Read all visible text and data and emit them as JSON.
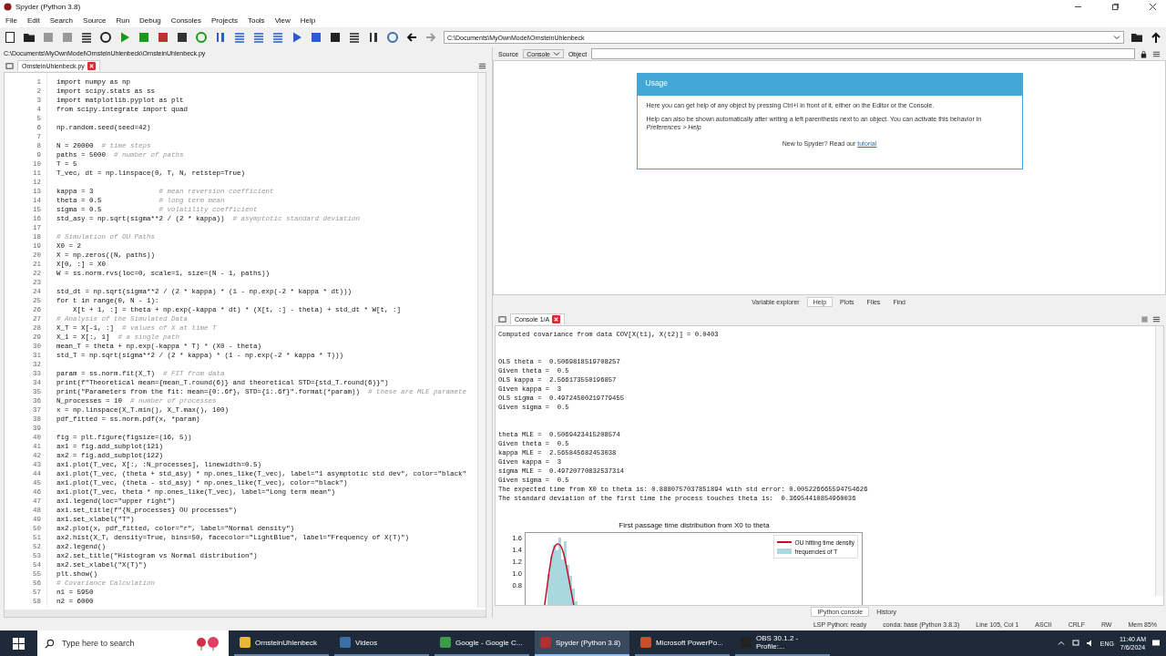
{
  "window": {
    "title": "Spyder (Python 3.8)"
  },
  "menu": [
    "File",
    "Edit",
    "Search",
    "Source",
    "Run",
    "Debug",
    "Consoles",
    "Projects",
    "Tools",
    "View",
    "Help"
  ],
  "toolbar": {
    "path": "C:\\Documents\\MyOwnModel\\OrnsteinUhlenbeck"
  },
  "editor": {
    "file_path": "C:\\Documents\\MyOwnModel\\OrnsteinUhlenbeck\\OrnsteinUhlenbeck.py",
    "tabs": [
      {
        "label": "OrnsteinUhlenbeck.py",
        "selected": true
      }
    ],
    "lines": [
      {
        "n": "1",
        "code": "import numpy as np"
      },
      {
        "n": "2",
        "code": "import scipy.stats as ss"
      },
      {
        "n": "3",
        "code": "import matplotlib.pyplot as plt"
      },
      {
        "n": "4",
        "code": "from scipy.integrate import quad"
      },
      {
        "n": "5"
      },
      {
        "n": "6",
        "code": "np.random.seed(seed=42)"
      },
      {
        "n": "7"
      },
      {
        "n": "8",
        "code": "N = 20000  ",
        "comment": "# time steps"
      },
      {
        "n": "9",
        "code": "paths = 5000  ",
        "comment": "# number of paths"
      },
      {
        "n": "10",
        "code": "T = 5"
      },
      {
        "n": "11",
        "code": "T_vec, dt = np.linspace(0, T, N, retstep=True)"
      },
      {
        "n": "12"
      },
      {
        "n": "13",
        "code": "kappa = 3                ",
        "comment": "# mean reversion coefficient"
      },
      {
        "n": "14",
        "code": "theta = 0.5              ",
        "comment": "# long term mean"
      },
      {
        "n": "15",
        "code": "sigma = 0.5              ",
        "comment": "# volatility coefficient"
      },
      {
        "n": "16",
        "code": "std_asy = np.sqrt(sigma**2 / (2 * kappa))  ",
        "comment": "# asymptotic standard deviation"
      },
      {
        "n": "17"
      },
      {
        "n": "18",
        "comment": "# Simulation of OU Paths"
      },
      {
        "n": "19",
        "code": "X0 = 2"
      },
      {
        "n": "20",
        "code": "X = np.zeros((N, paths))"
      },
      {
        "n": "21",
        "code": "X[0, :] = X0"
      },
      {
        "n": "22",
        "code": "W = ss.norm.rvs(loc=0, scale=1, size=(N - 1, paths))"
      },
      {
        "n": "23"
      },
      {
        "n": "24",
        "code": "std_dt = np.sqrt(sigma**2 / (2 * kappa) * (1 - np.exp(-2 * kappa * dt)))"
      },
      {
        "n": "25",
        "code": "for t in range(0, N - 1):"
      },
      {
        "n": "26",
        "code": "    X[t + 1, :] = theta + np.exp(-kappa * dt) * (X[t, :] - theta) + std_dt * W[t, :]"
      },
      {
        "n": "27",
        "comment": "# Analysis of the Simulated Data"
      },
      {
        "n": "28",
        "code": "X_T = X[-1, :]  ",
        "comment": "# values of X at time T"
      },
      {
        "n": "29",
        "code": "X_1 = X[:, 1]  ",
        "comment": "# a single path"
      },
      {
        "n": "30",
        "code": "mean_T = theta + np.exp(-kappa * T) * (X0 - theta)"
      },
      {
        "n": "31",
        "code": "std_T = np.sqrt(sigma**2 / (2 * kappa) * (1 - np.exp(-2 * kappa * T)))"
      },
      {
        "n": "32"
      },
      {
        "n": "33",
        "code": "param = ss.norm.fit(X_T)  ",
        "comment": "# FIT from data"
      },
      {
        "n": "34",
        "code": "print(f\"Theoretical mean={mean_T.round(6)} and theoretical STD={std_T.round(6)}\")"
      },
      {
        "n": "35",
        "code": "print(\"Parameters from the fit: mean={0:.6f}, STD={1:.6f}\".format(*param))  ",
        "comment": "# these are MLE paramete"
      },
      {
        "n": "36",
        "code": "N_processes = 10  ",
        "comment": "# number of processes"
      },
      {
        "n": "37",
        "code": "x = np.linspace(X_T.min(), X_T.max(), 100)"
      },
      {
        "n": "38",
        "code": "pdf_fitted = ss.norm.pdf(x, *param)"
      },
      {
        "n": "39"
      },
      {
        "n": "40",
        "code": "fig = plt.figure(figsize=(16, 5))"
      },
      {
        "n": "41",
        "code": "ax1 = fig.add_subplot(121)"
      },
      {
        "n": "42",
        "code": "ax2 = fig.add_subplot(122)"
      },
      {
        "n": "43",
        "code": "ax1.plot(T_vec, X[:, :N_processes], linewidth=0.5)"
      },
      {
        "n": "44",
        "code": "ax1.plot(T_vec, (theta + std_asy) * np.ones_like(T_vec), label=\"1 asymptotic std dev\", color=\"black\""
      },
      {
        "n": "45",
        "code": "ax1.plot(T_vec, (theta - std_asy) * np.ones_like(T_vec), color=\"black\")"
      },
      {
        "n": "46",
        "code": "ax1.plot(T_vec, theta * np.ones_like(T_vec), label=\"Long term mean\")"
      },
      {
        "n": "47",
        "code": "ax1.legend(loc=\"upper right\")"
      },
      {
        "n": "48",
        "code": "ax1.set_title(f\"{N_processes} OU processes\")"
      },
      {
        "n": "49",
        "code": "ax1.set_xlabel(\"T\")"
      },
      {
        "n": "50",
        "code": "ax2.plot(x, pdf_fitted, color=\"r\", label=\"Normal density\")"
      },
      {
        "n": "51",
        "code": "ax2.hist(X_T, density=True, bins=50, facecolor=\"LightBlue\", label=\"Frequency of X(T)\")"
      },
      {
        "n": "52",
        "code": "ax2.legend()"
      },
      {
        "n": "53",
        "code": "ax2.set_title(\"Histogram vs Normal distribution\")"
      },
      {
        "n": "54",
        "code": "ax2.set_xlabel(\"X(T)\")"
      },
      {
        "n": "55",
        "code": "plt.show()"
      },
      {
        "n": "56",
        "comment": "# Covariance Calculation"
      },
      {
        "n": "57",
        "code": "n1 = 5950"
      },
      {
        "n": "58",
        "code": "n2 = 6000"
      }
    ]
  },
  "help": {
    "source_label": "Source",
    "source_value": "Console",
    "object_label": "Object",
    "usage_title": "Usage",
    "paragraphs": [
      "Here you can get help of any object by pressing Ctrl+I in front of it, either on the Editor or the Console.",
      "Help can also be shown automatically after writing a left parenthesis next to an object. You can activate this behavior in *Preferences > Help*"
    ],
    "intro": "New to Spyder? Read our",
    "link": "tutorial",
    "tabs": [
      {
        "label": "Variable explorer",
        "selected": false
      },
      {
        "label": "Help",
        "selected": true
      },
      {
        "label": "Plots",
        "selected": false
      },
      {
        "label": "Files",
        "selected": false
      },
      {
        "label": "Find",
        "selected": false
      }
    ]
  },
  "console": {
    "tabs": [
      {
        "label": "Console 1/A",
        "selected": true
      }
    ],
    "blocks": [
      [
        "Computed covariance from data COV[X(t1), X(t2)] = 0.0403"
      ],
      [
        "OLS theta =  0.5069818519708257",
        "Given theta =  0.5",
        "OLS kappa =  2.566173550196857",
        "Given kappa =  3",
        "OLS sigma =  0.49724500219779455",
        "Given sigma =  0.5"
      ],
      [
        "theta MLE =  0.5069423415208574",
        "Given theta =  0.5",
        "kappa MLE =  2.565845682453038",
        "Given kappa =  3",
        "sigma MLE =  0.49720770832537314",
        "Given sigma =  0.5",
        "The expected time from X0 to theta is: 0.8880757037851894 with std error: 0.005226665594754626",
        "The standard deviation of the first time the process touches theta is:  0.36954410854960036"
      ]
    ],
    "plot": {
      "title": "First passage time distribution from X0 to theta",
      "yticks": [
        "1.6",
        "1.4",
        "1.2",
        "1.0",
        "0.8"
      ],
      "legend": [
        {
          "label": "OU hitting time density",
          "color": "#c0102a",
          "kind": "line"
        },
        {
          "label": "frequencies of T",
          "color": "#a8d8e0",
          "kind": "patch"
        }
      ]
    },
    "bottom_tabs": [
      {
        "label": "IPython console",
        "selected": true
      },
      {
        "label": "History",
        "selected": false
      }
    ]
  },
  "status_bar": [
    "LSP Python: ready",
    "conda: base (Python 3.8.3)",
    "Line 105, Col 1",
    "ASCII",
    "CRLF",
    "RW",
    "Mem 85%"
  ],
  "taskbar": {
    "search_placeholder": "Type here to search",
    "apps": [
      {
        "label": "OrnsteinUhlenbeck",
        "selected": false,
        "color": "#e8b830"
      },
      {
        "label": "Videos",
        "selected": false,
        "color": "#3a6ea5"
      },
      {
        "label": "Google - Google C...",
        "selected": false,
        "color": "#3c9a4a"
      },
      {
        "label": "Spyder (Python 3.8)",
        "selected": true,
        "color": "#b03030"
      },
      {
        "label": "Microsoft PowerPo...",
        "selected": false,
        "color": "#c8502a"
      },
      {
        "label": "OBS 30.1.2 - Profile:...",
        "selected": false,
        "color": "#222222"
      }
    ],
    "language": "ENG",
    "time": "11:40 AM",
    "date": "7/6/2024"
  }
}
